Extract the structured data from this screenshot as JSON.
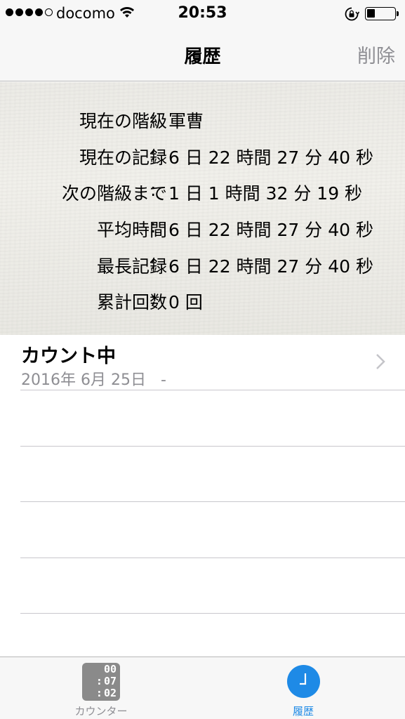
{
  "status_bar": {
    "carrier": "docomo",
    "time": "20:53",
    "signal_bars_filled": 4,
    "signal_bars_total": 5,
    "battery_level": 0.3
  },
  "nav": {
    "title": "履歴",
    "action_label": "削除"
  },
  "stats": [
    {
      "label": "現在の階級",
      "value": "軍曹"
    },
    {
      "label": "現在の記録",
      "value": "6 日 22 時間 27 分 40 秒"
    },
    {
      "label": "次の階級まで",
      "value": "1 日 1 時間 32 分 19 秒"
    },
    {
      "label": "平均時間",
      "value": "6 日 22 時間 27 分 40 秒"
    },
    {
      "label": "最長記録",
      "value": "6 日 22 時間 27 分 40 秒"
    },
    {
      "label": "累計回数",
      "value": "0 回"
    }
  ],
  "colon": ":",
  "history": [
    {
      "title": "カウント中",
      "date": "2016年 6月 25日",
      "end": "-"
    }
  ],
  "tabs": {
    "counter": {
      "label": "カウンター",
      "icon": "counter-icon",
      "icon_digits": [
        "00",
        "07",
        "02"
      ]
    },
    "history": {
      "label": "履歴",
      "icon": "clock-icon"
    }
  },
  "colors": {
    "accent": "#1e8ae6",
    "inactive": "#8e8e93"
  }
}
